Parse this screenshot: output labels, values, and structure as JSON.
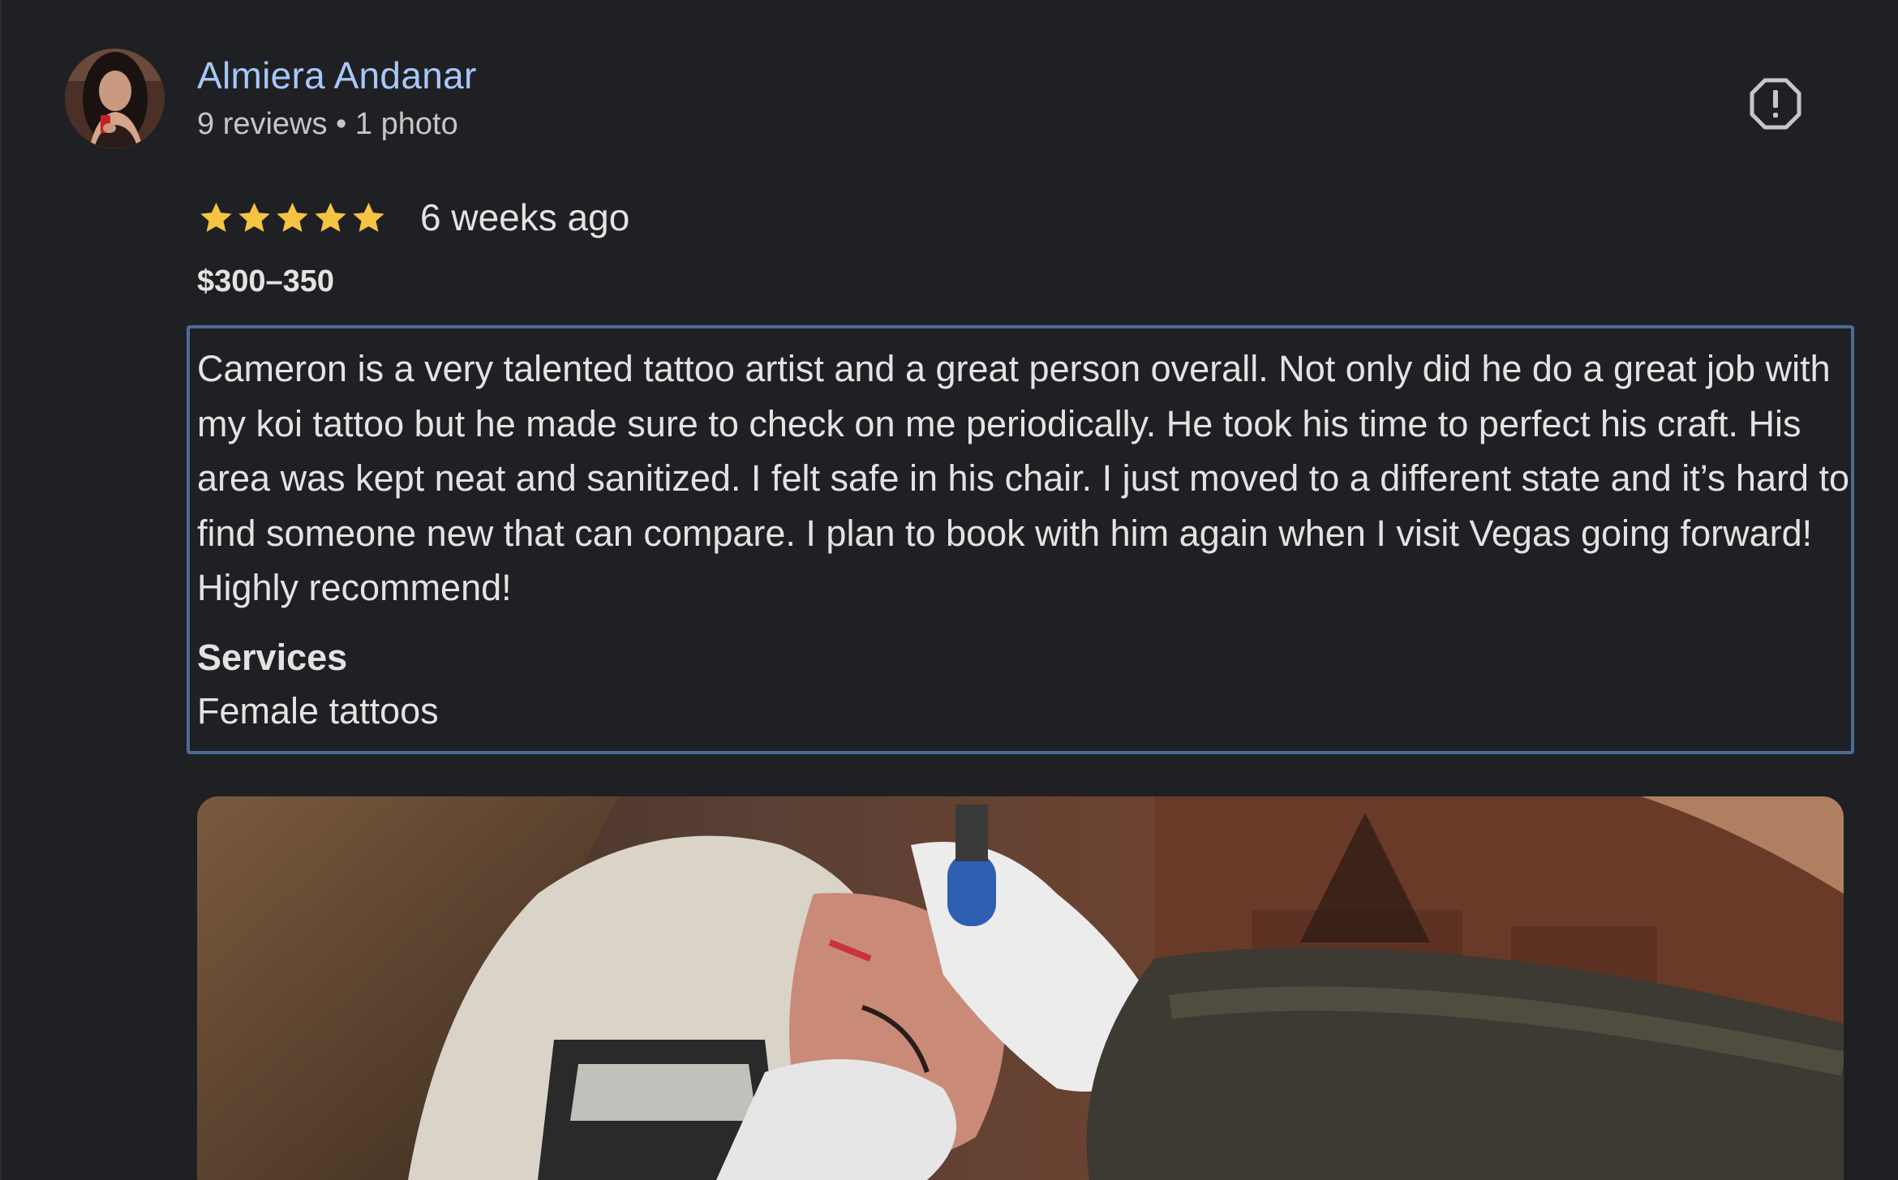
{
  "review": {
    "author": {
      "name": "Almiera Andanar",
      "meta": "9 reviews • 1 photo",
      "avatar_icon": "user-avatar-photo"
    },
    "rating": {
      "stars": 5,
      "max": 5,
      "color": "#f6c343"
    },
    "date": "6 weeks ago",
    "price": "$300–350",
    "text": "Cameron is a very talented tattoo artist and a great person overall. Not only did he do a great job with my koi tattoo but he made sure to check on me periodically. He took his time to perfect his craft. His area was kept neat and sanitized. I felt safe in his chair. I just moved to a different state and it’s hard to find someone new that can compare. I plan to book with him again when I visit Vegas going forward! Highly recommend!",
    "services": {
      "heading": "Services",
      "value": "Female tattoos"
    },
    "photo_icon": "review-photo-tattoo-session"
  },
  "icons": {
    "report": "report-icon",
    "star": "star-icon"
  },
  "colors": {
    "background": "#1f2023",
    "author_link": "#a8c7fa",
    "text": "#e3e3e3",
    "muted": "#c4c7c5",
    "focus_border": "#4a6c96"
  }
}
